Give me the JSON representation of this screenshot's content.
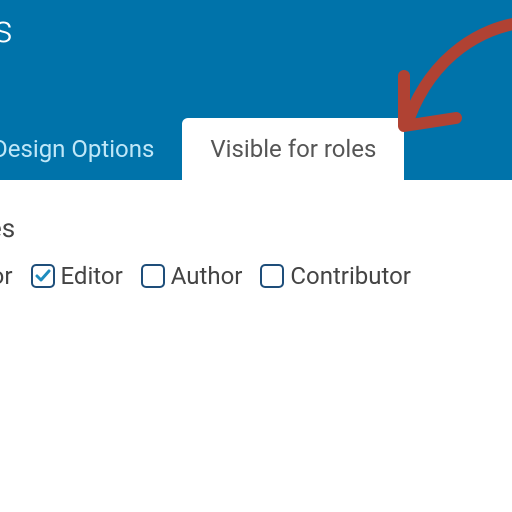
{
  "header": {
    "title_suffix": "gs"
  },
  "tabs": {
    "design": {
      "label": "Design Options"
    },
    "visible": {
      "label": "Visible for roles"
    }
  },
  "section": {
    "heading_suffix": "es"
  },
  "roles": [
    {
      "id": "administrator",
      "label_visible_suffix": "ator",
      "checked": false,
      "partial": true
    },
    {
      "id": "editor",
      "label": "Editor",
      "checked": true
    },
    {
      "id": "author",
      "label": "Author",
      "checked": false
    },
    {
      "id": "contributor",
      "label": "Contributor",
      "checked": false
    }
  ],
  "colors": {
    "header_bg": "#0073aa",
    "checkbox_border": "#1e4e7a",
    "check_color": "#1e8cbe",
    "arrow": "#b04233"
  }
}
